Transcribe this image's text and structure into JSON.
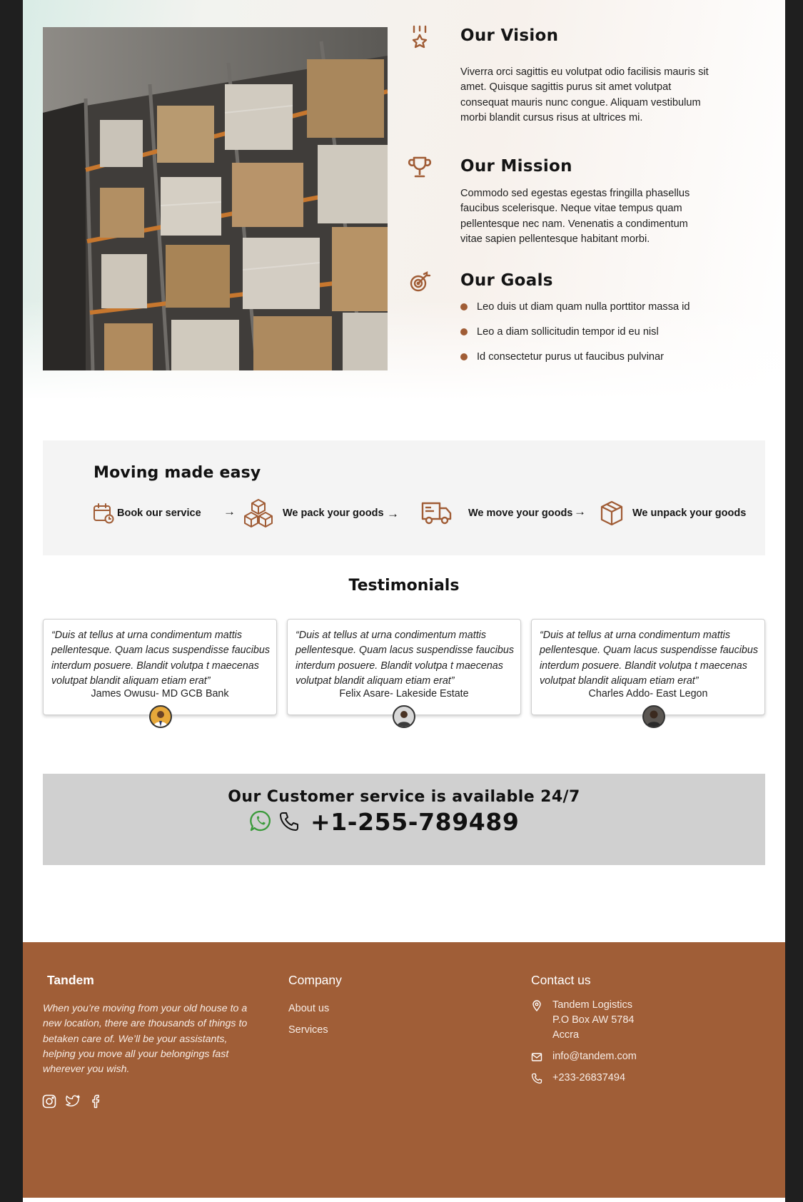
{
  "colors": {
    "accent": "#a05e37",
    "footer_bg": "#a05e37",
    "service_bg": "#d0d0d0",
    "moving_bg": "#f4f4f4"
  },
  "hero": {
    "image": "warehouse-shelves-image",
    "vision": {
      "icon": "medal-icon",
      "title": "Our Vision",
      "text": "Viverra orci sagittis eu volutpat odio facilisis mauris sit amet. Quisque sagittis purus sit amet volutpat consequat mauris nunc congue. Aliquam vestibulum morbi blandit cursus risus at ultrices mi."
    },
    "mission": {
      "icon": "trophy-icon",
      "title": "Our Mission",
      "text": "Commodo sed egestas egestas fringilla phasellus faucibus scelerisque. Neque vitae tempus quam pellentesque nec nam. Venenatis a condimentum vitae sapien pellentesque habitant morbi."
    },
    "goals": {
      "icon": "target-icon",
      "title": "Our Goals",
      "items": [
        "Leo duis ut diam quam nulla porttitor massa id",
        "Leo a diam sollicitudin tempor id eu nisl",
        "Id consectetur purus ut faucibus pulvinar"
      ]
    }
  },
  "moving": {
    "title": "Moving made easy",
    "steps": [
      {
        "icon": "calendar-clock-icon",
        "label": "Book our service"
      },
      {
        "icon": "boxes-icon",
        "label": "We pack your goods"
      },
      {
        "icon": "truck-icon",
        "label": "We move your goods"
      },
      {
        "icon": "box-icon",
        "label": "We unpack your goods"
      }
    ],
    "arrow": "→"
  },
  "testimonials": {
    "title": "Testimonials",
    "items": [
      {
        "quote": "“Duis at tellus at urna condimentum mattis pellentesque. Quam lacus suspendisse faucibus interdum posuere. Blandit volutpa t maecenas volutpat blandit aliquam etiam erat”",
        "author": "James Owusu- MD GCB Bank"
      },
      {
        "quote": "“Duis at tellus at urna condimentum mattis pellentesque. Quam lacus suspendisse faucibus interdum posuere. Blandit volutpa t maecenas volutpat blandit aliquam etiam erat”",
        "author": "Felix Asare-  Lakeside Estate"
      },
      {
        "quote": "“Duis at tellus at urna condimentum mattis pellentesque. Quam lacus suspendisse faucibus interdum posuere. Blandit volutpa t maecenas volutpat blandit aliquam etiam erat”",
        "author": "Charles Addo- East Legon"
      }
    ]
  },
  "service": {
    "title": "Our Customer service is available 24/7",
    "phone": "+1-255-789489"
  },
  "footer": {
    "brand": "Tandem",
    "about": "When you’re moving from your old house to a new location, there are thousands of things to betaken care of. We’ll be your assistants, helping you move all your belongings fast wherever you wish.",
    "company_title": "Company",
    "links": [
      "About us",
      "Services"
    ],
    "contact_title": "Contact us",
    "address": [
      "Tandem Logistics",
      "P.O Box AW 5784",
      "Accra"
    ],
    "email": "info@tandem.com",
    "phone": "+233-26837494"
  }
}
